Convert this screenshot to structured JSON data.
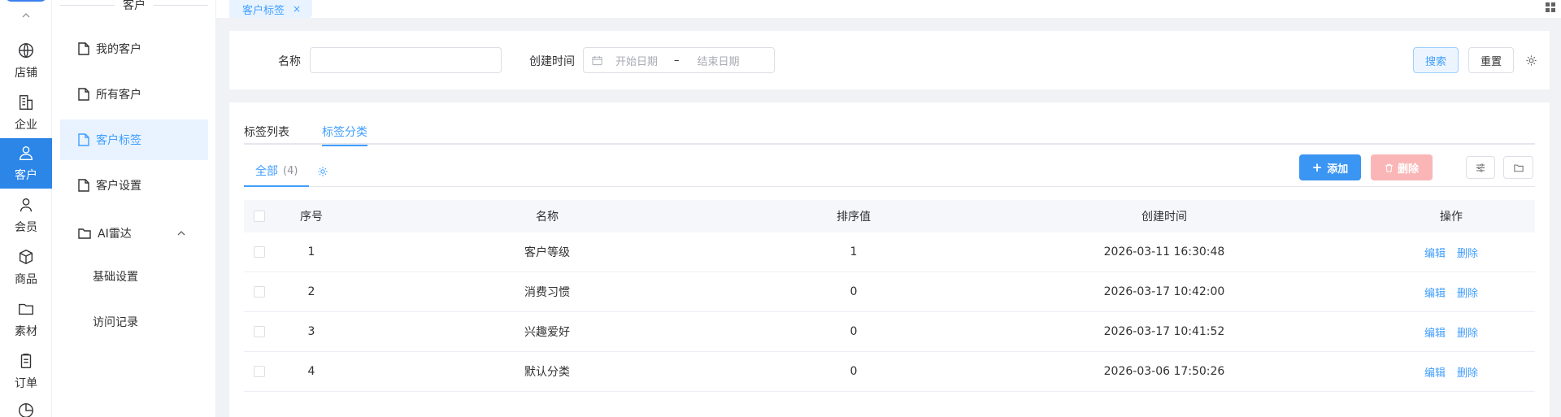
{
  "rail": {
    "items": [
      {
        "label": "店铺",
        "icon": "globe-icon"
      },
      {
        "label": "企业",
        "icon": "building-icon"
      },
      {
        "label": "客户",
        "icon": "customer-icon",
        "active": true
      },
      {
        "label": "会员",
        "icon": "member-icon"
      },
      {
        "label": "商品",
        "icon": "box-icon"
      },
      {
        "label": "素材",
        "icon": "folder-icon"
      },
      {
        "label": "订单",
        "icon": "clipboard-icon"
      }
    ]
  },
  "sidebar": {
    "title": "客户",
    "items": [
      {
        "label": "我的客户"
      },
      {
        "label": "所有客户"
      },
      {
        "label": "客户标签",
        "active": true
      },
      {
        "label": "客户设置"
      }
    ],
    "group": {
      "label": "AI雷达",
      "children": [
        {
          "label": "基础设置"
        },
        {
          "label": "访问记录"
        }
      ]
    }
  },
  "tabs": {
    "open": [
      {
        "label": "客户标签",
        "close": "×"
      }
    ]
  },
  "search": {
    "name_label": "名称",
    "name_value": "",
    "time_label": "创建时间",
    "start_placeholder": "开始日期",
    "separator": "–",
    "end_placeholder": "结束日期",
    "search_button": "搜索",
    "reset_button": "重置"
  },
  "main": {
    "subtabs": [
      {
        "label": "标签列表"
      },
      {
        "label": "标签分类",
        "active": true
      }
    ],
    "category_tab": {
      "label": "全部",
      "count": "(4)"
    },
    "add_button": "添加",
    "delete_button": "删除",
    "columns": [
      "序号",
      "名称",
      "排序值",
      "创建时间",
      "操作"
    ],
    "rows": [
      {
        "index": "1",
        "name": "客户等级",
        "sort": "1",
        "created": "2026-03-11 16:30:48"
      },
      {
        "index": "2",
        "name": "消费习惯",
        "sort": "0",
        "created": "2026-03-17 10:42:00"
      },
      {
        "index": "3",
        "name": "兴趣爱好",
        "sort": "0",
        "created": "2026-03-17 10:41:52"
      },
      {
        "index": "4",
        "name": "默认分类",
        "sort": "0",
        "created": "2026-03-06 17:50:26"
      }
    ],
    "row_actions": {
      "edit": "编辑",
      "delete": "删除"
    }
  },
  "colors": {
    "primary": "#409eff",
    "rail_active": "#2b86e8",
    "danger_disabled": "#fab6b6"
  }
}
